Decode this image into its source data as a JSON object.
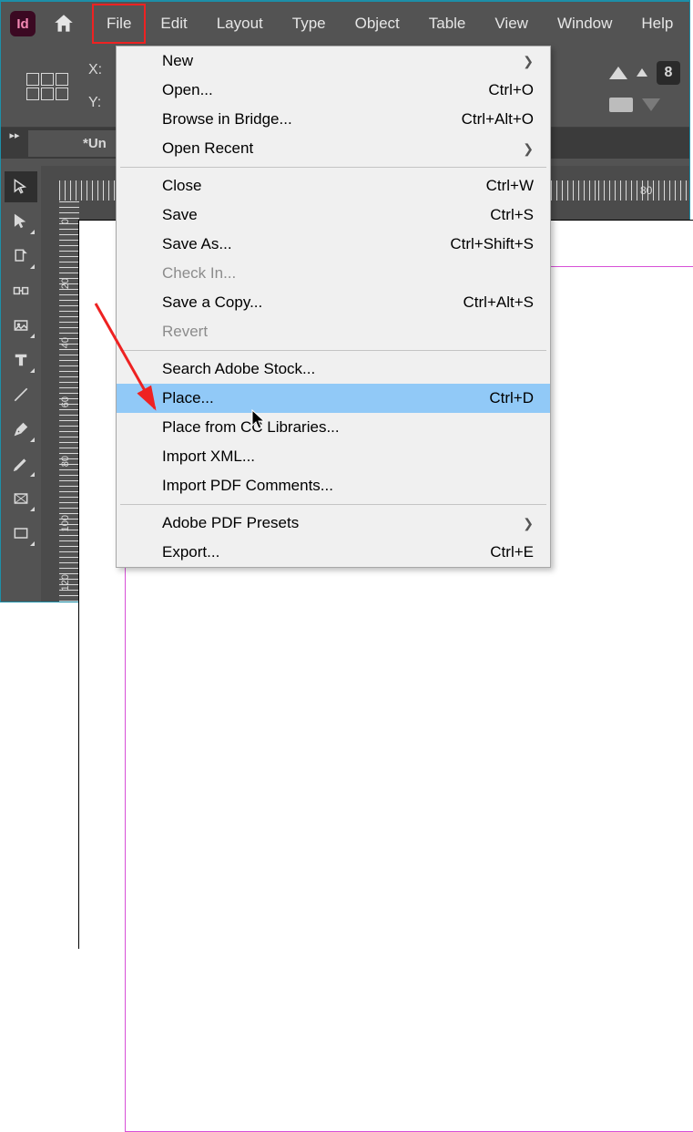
{
  "app_icon": "Id",
  "menubar": [
    "File",
    "Edit",
    "Layout",
    "Type",
    "Object",
    "Table",
    "View",
    "Window",
    "Help"
  ],
  "highlighted_menu": "File",
  "options": {
    "x_label": "X:",
    "y_label": "Y:",
    "clip_badge": "8"
  },
  "document_tab": "*Un",
  "expand_handle": "▸▸",
  "hruler_end_tick": "80",
  "vruler_ticks": [
    "0",
    "20",
    "40",
    "60",
    "80",
    "100",
    "120"
  ],
  "dropdown": {
    "groups": [
      [
        {
          "label": "New",
          "shortcut": "",
          "submenu": true
        },
        {
          "label": "Open...",
          "shortcut": "Ctrl+O"
        },
        {
          "label": "Browse in Bridge...",
          "shortcut": "Ctrl+Alt+O"
        },
        {
          "label": "Open Recent",
          "shortcut": "",
          "submenu": true
        }
      ],
      [
        {
          "label": "Close",
          "shortcut": "Ctrl+W"
        },
        {
          "label": "Save",
          "shortcut": "Ctrl+S"
        },
        {
          "label": "Save As...",
          "shortcut": "Ctrl+Shift+S"
        },
        {
          "label": "Check In...",
          "shortcut": "",
          "disabled": true
        },
        {
          "label": "Save a Copy...",
          "shortcut": "Ctrl+Alt+S"
        },
        {
          "label": "Revert",
          "shortcut": "",
          "disabled": true
        }
      ],
      [
        {
          "label": "Search Adobe Stock...",
          "shortcut": ""
        },
        {
          "label": "Place...",
          "shortcut": "Ctrl+D",
          "highlight": true
        },
        {
          "label": "Place from CC Libraries...",
          "shortcut": ""
        },
        {
          "label": "Import XML...",
          "shortcut": ""
        },
        {
          "label": "Import PDF Comments...",
          "shortcut": ""
        }
      ],
      [
        {
          "label": "Adobe PDF Presets",
          "shortcut": "",
          "submenu": true
        },
        {
          "label": "Export...",
          "shortcut": "Ctrl+E"
        }
      ]
    ]
  },
  "submenu_glyph": "❯"
}
